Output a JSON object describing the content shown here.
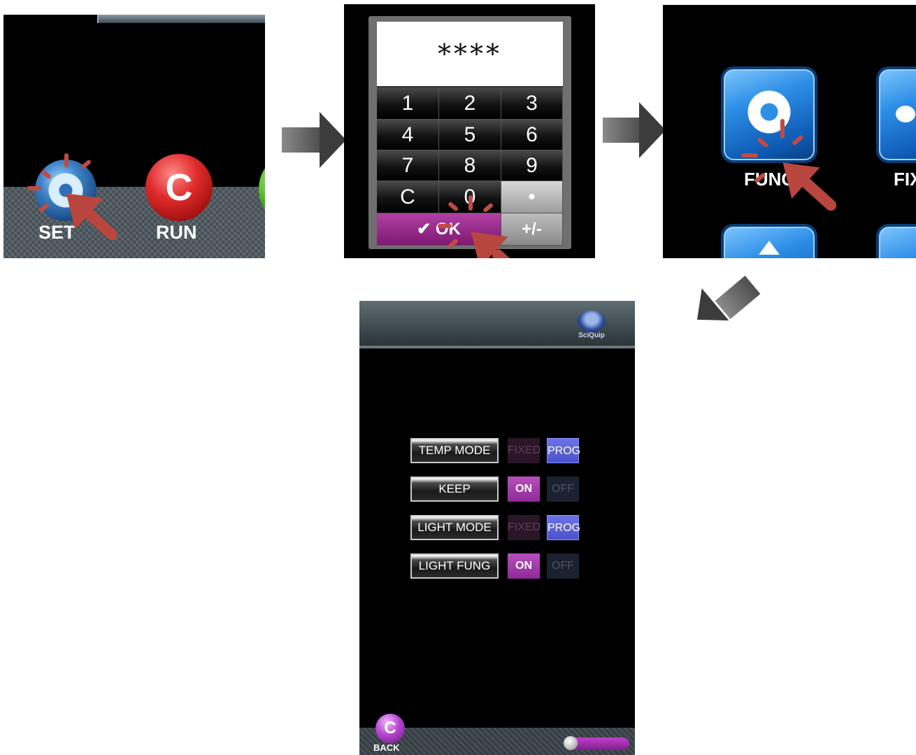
{
  "step1": {
    "set_label": "SET",
    "run_label": "RUN"
  },
  "step2": {
    "password_mask": "****",
    "keys": [
      "1",
      "2",
      "3",
      "4",
      "5",
      "6",
      "7",
      "8",
      "9",
      "C",
      "0",
      "•"
    ],
    "ok_label": "✔ OK",
    "plus_minus_label": "+/-"
  },
  "step3": {
    "func_label": "FUNC",
    "fixed_label": "FIX"
  },
  "step4": {
    "logo_text": "SciQuip",
    "rows": [
      {
        "label": "TEMP MODE",
        "left": "FIXED",
        "right": "PROG",
        "selected": "right"
      },
      {
        "label": "KEEP",
        "left": "ON",
        "right": "OFF",
        "selected": "left"
      },
      {
        "label": "LIGHT MODE",
        "left": "FIXED",
        "right": "PROG",
        "selected": "right"
      },
      {
        "label": "LIGHT FUNG",
        "left": "ON",
        "right": "OFF",
        "selected": "left"
      }
    ],
    "back_label": "BACK"
  },
  "colors": {
    "pointer": "#b8463f",
    "accent_purple": "#8e2b99",
    "prog_blue": "#4b52cc"
  }
}
